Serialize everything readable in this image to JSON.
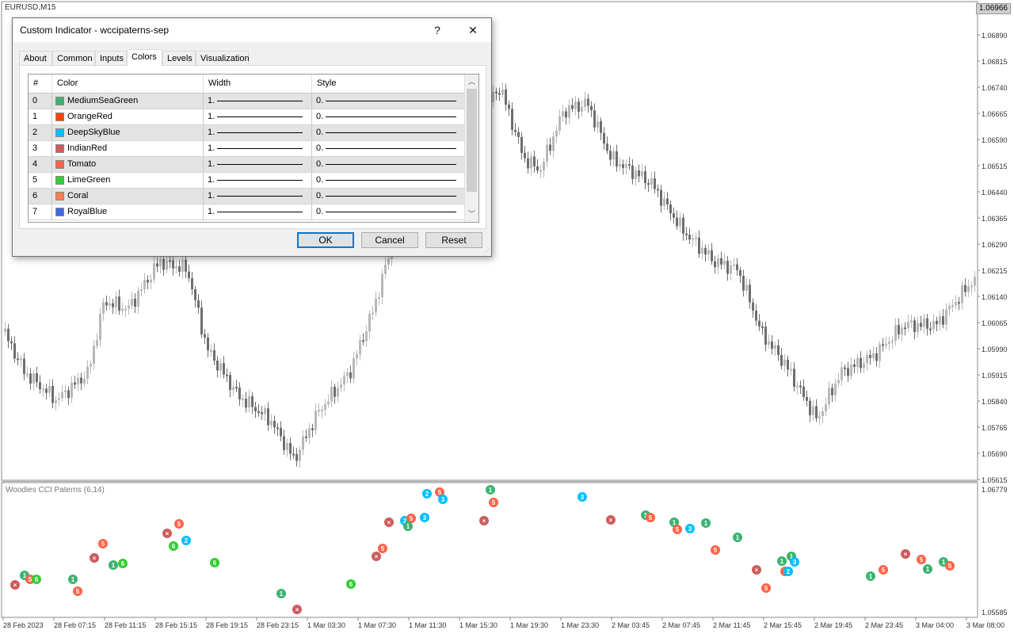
{
  "chart": {
    "symbol": "EURUSD,M15",
    "current_price": "1.06966",
    "price_labels": [
      "1.06890",
      "1.06815",
      "1.06740",
      "1.06665",
      "1.06590",
      "1.06515",
      "1.06440",
      "1.06365",
      "1.06290",
      "1.06215",
      "1.06140",
      "1.06065",
      "1.05990",
      "1.05915",
      "1.05840",
      "1.05765",
      "1.05690",
      "1.05615"
    ],
    "indicator_name": "Woodies CCI Paterns (6,14)",
    "indicator_price_labels": [
      "1.06779",
      "1.05585"
    ],
    "time_labels": [
      "28 Feb 2023",
      "28 Feb 07:15",
      "28 Feb 11:15",
      "28 Feb 15:15",
      "28 Feb 19:15",
      "28 Feb 23:15",
      "1 Mar 03:30",
      "1 Mar 07:30",
      "1 Mar 11:30",
      "1 Mar 15:30",
      "1 Mar 19:30",
      "1 Mar 23:30",
      "2 Mar 03:45",
      "2 Mar 07:45",
      "2 Mar 11:45",
      "2 Mar 15:45",
      "2 Mar 19:45",
      "2 Mar 23:45",
      "3 Mar 04:00",
      "3 Mar 08:00"
    ],
    "colors": {
      "candle_up": "#b8b8b8",
      "candle_down": "#6e6e6e",
      "medium_sea_green": "#3cb371",
      "orange_red": "#ff4500",
      "deep_sky_blue": "#00bfff",
      "indian_red": "#cd5c5c",
      "tomato": "#ff6347",
      "lime_green": "#32cd32",
      "coral": "#ff7f50",
      "royal_blue": "#4169e1"
    }
  },
  "dialog": {
    "title": "Custom Indicator - wccipaterns-sep",
    "help_label": "?",
    "close_label": "✕",
    "tabs": [
      "About",
      "Common",
      "Inputs",
      "Colors",
      "Levels",
      "Visualization"
    ],
    "active_tab": "Colors",
    "columns": [
      "#",
      "Color",
      "Width",
      "Style"
    ],
    "rows": [
      {
        "index": "0",
        "color": "MediumSeaGreen",
        "hex": "#3cb371",
        "width": "1.",
        "style": "0."
      },
      {
        "index": "1",
        "color": "OrangeRed",
        "hex": "#ff4500",
        "width": "1.",
        "style": "0."
      },
      {
        "index": "2",
        "color": "DeepSkyBlue",
        "hex": "#00bfff",
        "width": "1.",
        "style": "0."
      },
      {
        "index": "3",
        "color": "IndianRed",
        "hex": "#cd5c5c",
        "width": "1.",
        "style": "0."
      },
      {
        "index": "4",
        "color": "Tomato",
        "hex": "#ff6347",
        "width": "1.",
        "style": "0."
      },
      {
        "index": "5",
        "color": "LimeGreen",
        "hex": "#32cd32",
        "width": "1.",
        "style": "0."
      },
      {
        "index": "6",
        "color": "Coral",
        "hex": "#ff7f50",
        "width": "1.",
        "style": "0."
      },
      {
        "index": "7",
        "color": "RoyalBlue",
        "hex": "#4169e1",
        "width": "1.",
        "style": "0."
      }
    ],
    "buttons": {
      "ok": "OK",
      "cancel": "Cancel",
      "reset": "Reset"
    }
  }
}
